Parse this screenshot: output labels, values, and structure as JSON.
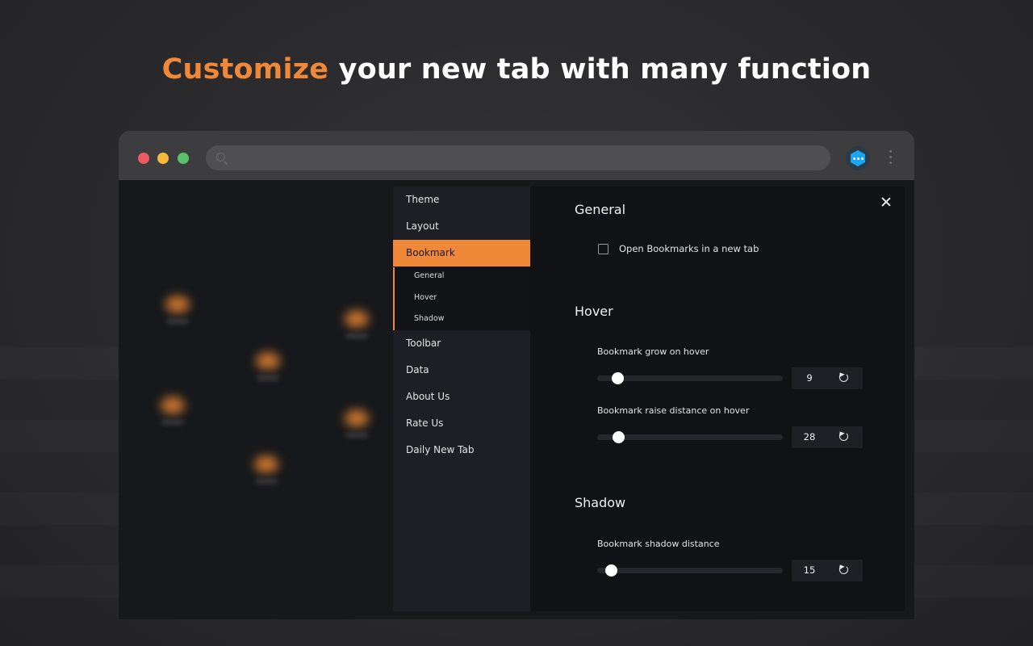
{
  "headline": {
    "accent": "Customize",
    "rest": "your new tab with many function"
  },
  "browser": {
    "traffic_lights": [
      "red",
      "yellow",
      "green"
    ],
    "extension_icon": "hexagon-dots-icon",
    "menu_icon": "kebab-menu-icon"
  },
  "settings": {
    "nav": {
      "items": [
        {
          "label": "Theme"
        },
        {
          "label": "Layout"
        },
        {
          "label": "Bookmark",
          "active": true
        },
        {
          "label": "Toolbar"
        },
        {
          "label": "Data"
        },
        {
          "label": "About Us"
        },
        {
          "label": "Rate Us"
        },
        {
          "label": "Daily New Tab"
        }
      ],
      "bookmark_sub": [
        "General",
        "Hover",
        "Shadow"
      ]
    },
    "general": {
      "title": "General",
      "open_new_tab": {
        "label": "Open Bookmarks in a new tab",
        "checked": false
      }
    },
    "hover": {
      "title": "Hover",
      "grow": {
        "label": "Bookmark grow on hover",
        "value": "9",
        "slider_fraction": 0.11
      },
      "raise": {
        "label": "Bookmark raise distance on hover",
        "value": "28",
        "slider_fraction": 0.115
      }
    },
    "shadow": {
      "title": "Shadow",
      "distance": {
        "label": "Bookmark shadow distance",
        "value": "15",
        "slider_fraction": 0.075
      }
    }
  },
  "colors": {
    "accent": "#f0883a",
    "panel_bg": "#111216",
    "nav_bg": "#1d1f25"
  }
}
